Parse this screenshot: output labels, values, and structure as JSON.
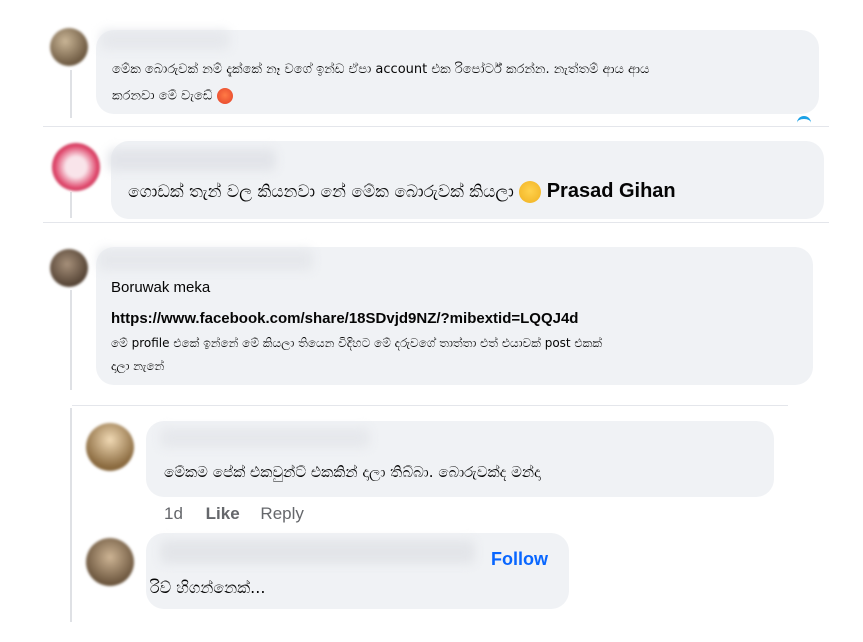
{
  "comments": [
    {
      "text": "මේක බොරුවක් නම් දැක්කේ නෑ වගේ ඉන්ඩ ඒපා account එක රිපෝර්ට් කරන්න. නැත්තම් ආය ආය",
      "text2": "කරනවා මේ වැඩේ",
      "emoji": "angry-face-icon"
    },
    {
      "text": "ගොඩක් තැන් වල කියනවා නේ මේක බොරුවක් කියලා",
      "emoji": "thinking-face-icon",
      "mention": "Prasad Gihan"
    },
    {
      "text": "Boruwak meka",
      "link": "https://www.facebook.com/share/18SDvjd9NZ/?mibextid=LQQJ4d",
      "text2": "මේ profile එකේ ඉන්නේ මේ කියලා තියෙන විදිහට මේ දරුවගේ තාත්තා එත් එයාවක් post එකක්",
      "text3": "දාලා නැනේ"
    },
    {
      "text": "මේකම පේක් එකවුන්ට් එකකින් දාලා තිබ්බා. බොරුවක්ද මන්දා",
      "time": "1d",
      "like": "Like",
      "reply": "Reply"
    },
    {
      "text": "රිව් හිගන්නෙක්...",
      "follow": "Follow"
    }
  ],
  "colors": {
    "bubble": "#f0f2f5",
    "link": "#0866ff",
    "meta": "#65676b"
  }
}
